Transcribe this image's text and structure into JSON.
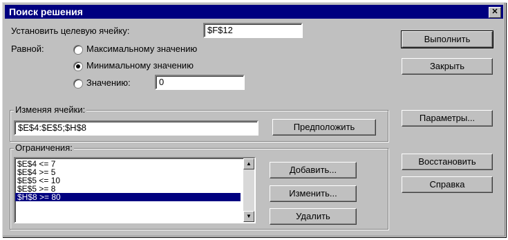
{
  "window": {
    "title": "Поиск решения",
    "close_icon": "close-icon"
  },
  "target": {
    "label": "Установить целевую ячейку:",
    "value": "$F$12"
  },
  "equal_to": {
    "label": "Равной:",
    "options": [
      {
        "label": "Максимальному значению",
        "selected": false
      },
      {
        "label": "Минимальному значению",
        "selected": true
      },
      {
        "label": "Значению:",
        "selected": false
      }
    ],
    "value": "0"
  },
  "changing": {
    "label": "Изменяя ячейки:",
    "value": "$E$4:$E$5;$H$8",
    "guess_button": "Предположить"
  },
  "constraints": {
    "label": "Ограничения:",
    "items": [
      "$E$4 <= 7",
      "$E$4 >= 5",
      "$E$5 <= 10",
      "$E$5 >= 8",
      "$H$8 >= 80"
    ],
    "selected_index": 4,
    "add_button": "Добавить...",
    "change_button": "Изменить...",
    "delete_button": "Удалить"
  },
  "buttons": {
    "solve": "Выполнить",
    "close": "Закрыть",
    "options": "Параметры...",
    "reset": "Восстановить",
    "help": "Справка"
  }
}
